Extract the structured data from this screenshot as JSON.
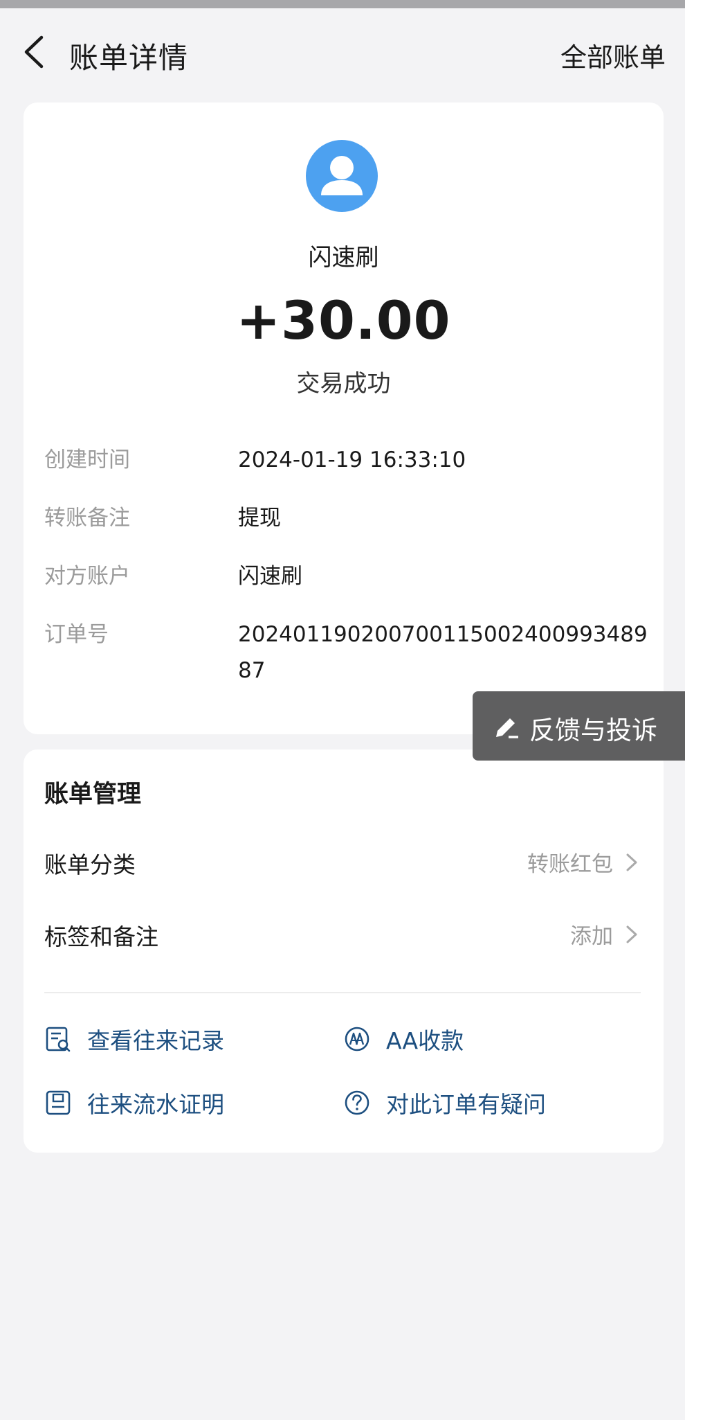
{
  "nav": {
    "title": "账单详情",
    "right_link": "全部账单"
  },
  "transaction": {
    "counterparty": "闪速刷",
    "amount": "+30.00",
    "status": "交易成功",
    "details": [
      {
        "label": "创建时间",
        "value": "2024-01-19 16:33:10"
      },
      {
        "label": "转账备注",
        "value": "提现"
      },
      {
        "label": "对方账户",
        "value": "闪速刷"
      },
      {
        "label": "订单号",
        "value": "20240119020070011500240099348987"
      }
    ]
  },
  "feedback": {
    "label": "反馈与投诉"
  },
  "manage": {
    "title": "账单管理",
    "rows": [
      {
        "label": "账单分类",
        "value": "转账红包"
      },
      {
        "label": "标签和备注",
        "value": "添加"
      }
    ],
    "actions": [
      {
        "label": "查看往来记录",
        "icon": "record-search-icon"
      },
      {
        "label": "AA收款",
        "icon": "aa-icon"
      },
      {
        "label": "往来流水证明",
        "icon": "statement-icon"
      },
      {
        "label": "对此订单有疑问",
        "icon": "question-icon"
      }
    ]
  },
  "colors": {
    "accent_blue": "#4da1f0",
    "action_text": "#1d4f80",
    "feedback_bg": "#5f5f60"
  }
}
